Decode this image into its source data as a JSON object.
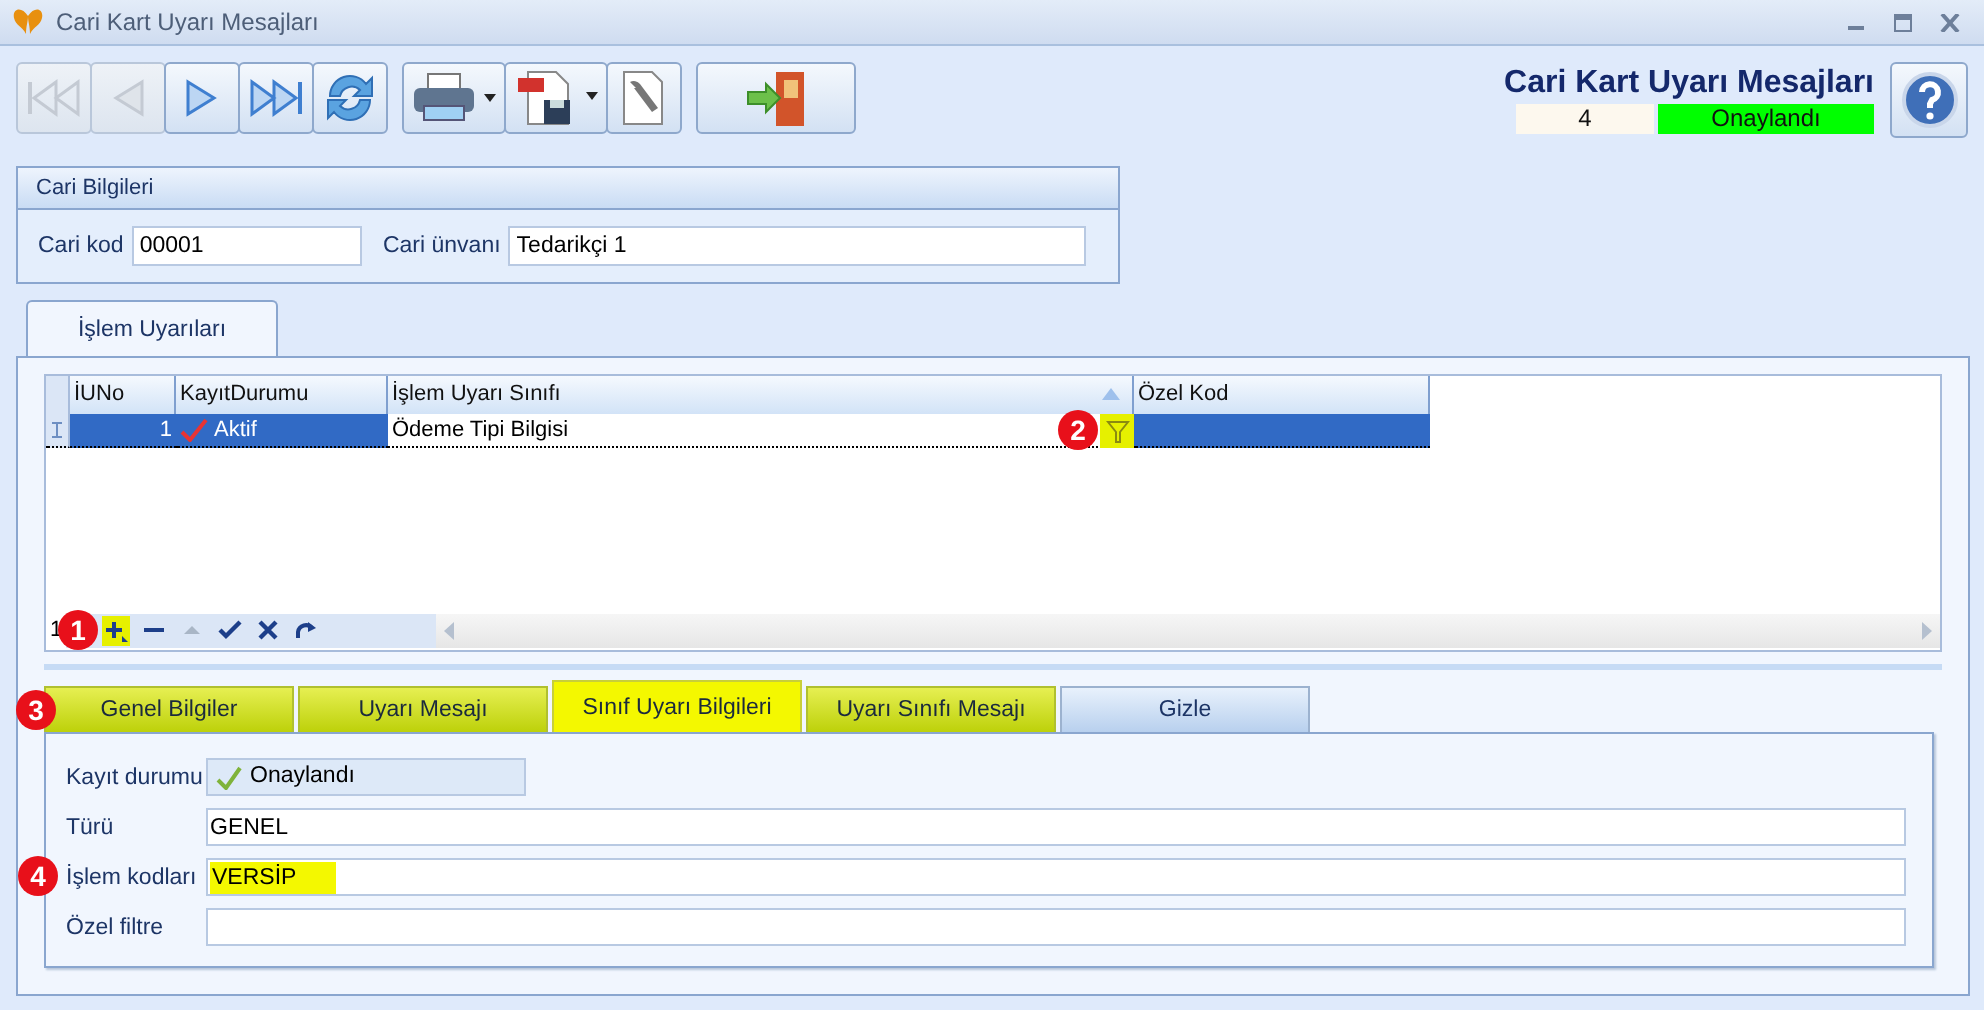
{
  "window": {
    "title": "Cari Kart Uyarı Mesajları"
  },
  "toolbar": {
    "groups": [
      {
        "buttons": [
          {
            "kind": "first",
            "disabled": true
          },
          {
            "kind": "prev",
            "disabled": true
          },
          {
            "kind": "next",
            "disabled": false
          },
          {
            "kind": "last",
            "disabled": false
          },
          {
            "kind": "refresh",
            "disabled": false
          }
        ]
      },
      {
        "buttons": [
          {
            "kind": "print",
            "disabled": false
          },
          {
            "kind": "pdf",
            "disabled": false
          },
          {
            "kind": "tools",
            "disabled": false
          }
        ]
      },
      {
        "buttons": [
          {
            "kind": "exit",
            "disabled": false
          }
        ]
      }
    ]
  },
  "header": {
    "title": "Cari Kart Uyarı Mesajları",
    "count": "4",
    "status": "Onaylandı"
  },
  "cari_bilgileri": {
    "title": "Cari Bilgileri",
    "fields": [
      {
        "label": "Cari kod",
        "value": "00001"
      },
      {
        "label": "Cari ünvanı",
        "value": "Tedarikçi 1"
      }
    ]
  },
  "tabs": [
    {
      "label": "İşlem Uyarıları",
      "selected": true
    }
  ],
  "grid": {
    "columns": [
      {
        "label": "İUNo",
        "sorted": false
      },
      {
        "label": "KayıtDurumu",
        "sorted": false
      },
      {
        "label": "İşlem Uyarı Sınıfı",
        "sorted": true
      },
      {
        "label": "Özel Kod",
        "sorted": false
      }
    ],
    "rows": [
      {
        "selected": true,
        "iuno": "1",
        "kayit_durumu": "Aktif",
        "islem_uyari_sinifi": "Ödeme Tipi Bilgisi",
        "filter_callout": "2"
      }
    ],
    "navigator": {
      "record": "1",
      "callout": "1",
      "buttons": [
        {
          "kind": "add",
          "highlighted": true,
          "disabled": false
        },
        {
          "kind": "remove",
          "highlighted": false,
          "disabled": false
        },
        {
          "kind": "up",
          "highlighted": false,
          "disabled": true
        },
        {
          "kind": "confirm",
          "highlighted": false,
          "disabled": false
        },
        {
          "kind": "cancel",
          "highlighted": false,
          "disabled": false
        },
        {
          "kind": "redo",
          "highlighted": false,
          "disabled": false
        }
      ]
    }
  },
  "detail_tabs": {
    "callout": "3",
    "items": [
      {
        "label": "Genel Bilgiler",
        "selected": false,
        "highlighted": true
      },
      {
        "label": "Uyarı Mesajı",
        "selected": false,
        "highlighted": true
      },
      {
        "label": "Sınıf Uyarı Bilgileri",
        "selected": true,
        "highlighted": true
      },
      {
        "label": "Uyarı Sınıfı Mesajı",
        "selected": false,
        "highlighted": true
      },
      {
        "label": "Gizle",
        "selected": false,
        "highlighted": false
      }
    ]
  },
  "detail": {
    "fields": [
      {
        "kind": "status",
        "label": "Kayıt durumu",
        "value": "Onaylandı",
        "highlighted": false
      },
      {
        "kind": "text",
        "label": "Türü",
        "value": "GENEL",
        "highlighted": false
      },
      {
        "kind": "text",
        "label": "İşlem kodları",
        "value": "VERSİP",
        "highlighted": true,
        "callout": "4"
      },
      {
        "kind": "text",
        "label": "Özel filtre",
        "highlighted": false
      }
    ]
  }
}
